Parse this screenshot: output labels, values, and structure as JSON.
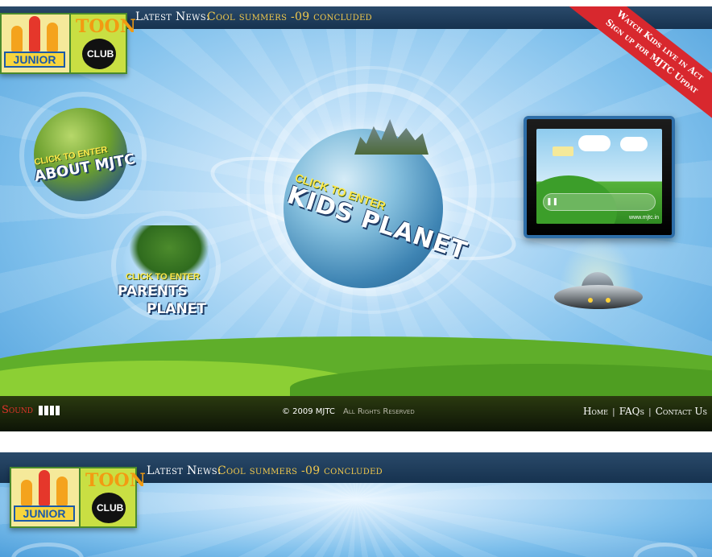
{
  "header": {
    "news_label": "Latest News:",
    "news_text": "Cool summers -09 concluded"
  },
  "logo": {
    "junior": "JUNIOR",
    "toon": "TOON",
    "club": "CLUB"
  },
  "corner_ribbon": {
    "line1": "Watch Kids live in Act",
    "line2": "Sign up for MJTC Updat"
  },
  "planets": {
    "about": {
      "small": "CLICK TO ENTER",
      "big": "ABOUT MJTC"
    },
    "parents": {
      "small": "CLICK TO ENTER",
      "big1": "PARENTS",
      "big2": "PLANET"
    },
    "kids": {
      "small": "CLICK TO ENTER",
      "big": "KIDS PLANET"
    }
  },
  "tv": {
    "url": "www.mjtc.in",
    "play_icon": "pause-icon"
  },
  "footer": {
    "sound_label": "Sound",
    "sound_level": 4,
    "copyright": "© 2009 MJTC",
    "rights": "All Rights Reserved",
    "links": [
      "Home",
      "FAQs",
      "Contact Us"
    ]
  },
  "colors": {
    "news_accent": "#f2c94c",
    "sound_accent": "#e0342a",
    "ribbon": "#d8282e"
  }
}
